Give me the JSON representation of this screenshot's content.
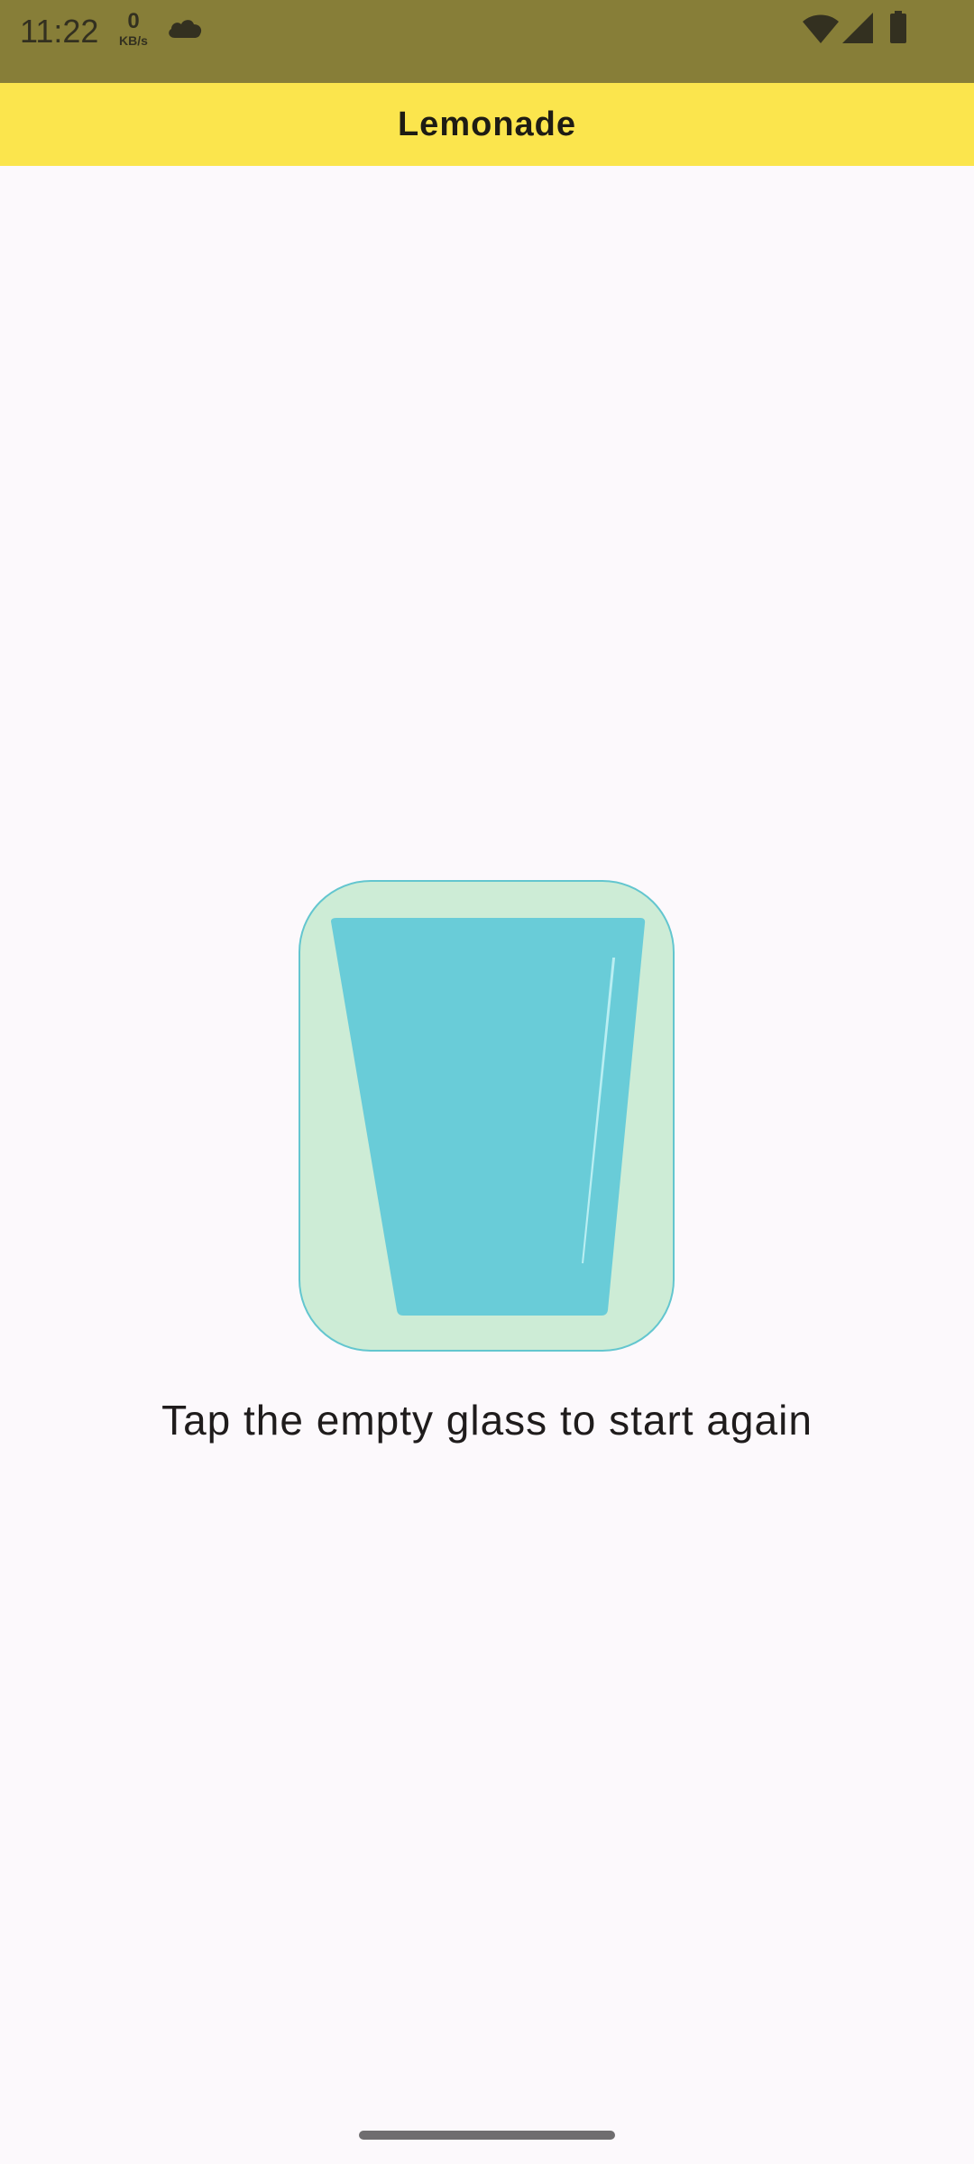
{
  "status_bar": {
    "time": "11:22",
    "net_speed_value": "0",
    "net_speed_unit": "KB/s",
    "icons": [
      "cloud-icon",
      "wifi-icon",
      "cell-signal-icon",
      "battery-icon"
    ]
  },
  "app_bar": {
    "title": "Lemonade"
  },
  "content": {
    "image_icon": "empty-glass-icon",
    "instruction": "Tap the empty glass to start again"
  },
  "colors": {
    "status_bar_bg": "#877e38",
    "app_bar_bg": "#fbe54d",
    "background": "#fcf9fc",
    "glass_card_bg": "#cdecd6",
    "glass_border": "#63c6cf",
    "glass_fill": "#69ccd8"
  }
}
